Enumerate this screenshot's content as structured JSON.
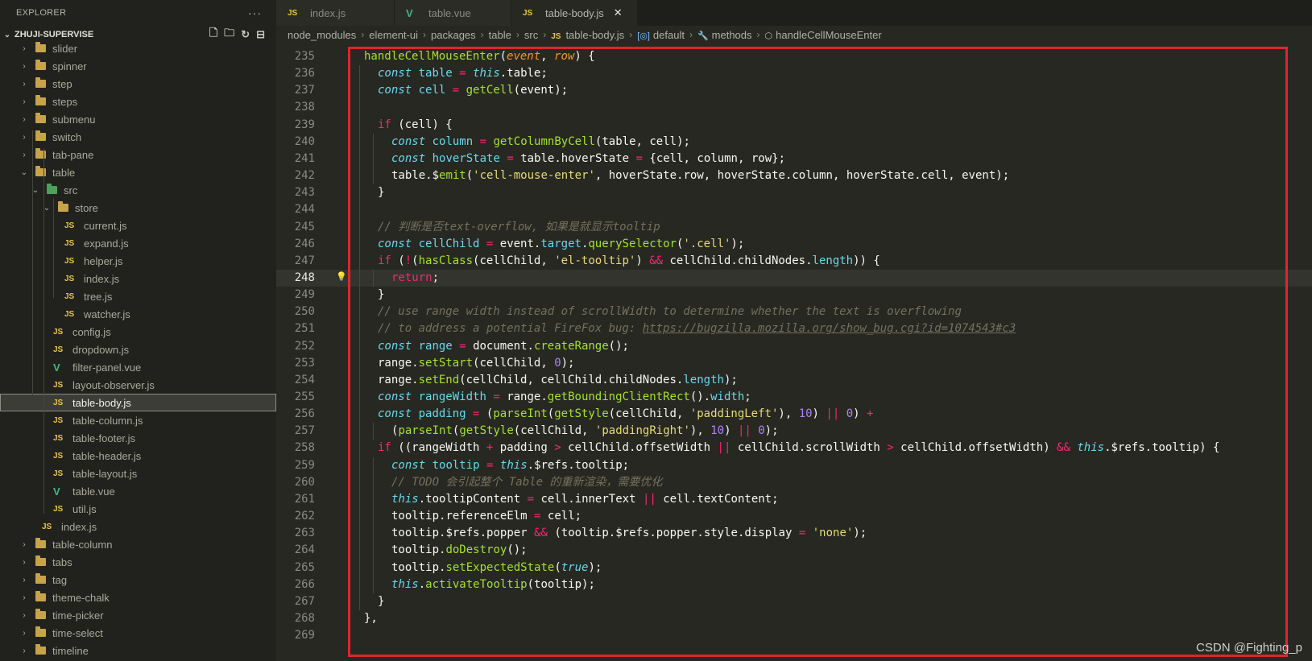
{
  "explorer": {
    "title": "EXPLORER",
    "more": "···",
    "project": "ZHUJI-SUPERVISE",
    "actions": [
      "new-file-icon",
      "new-folder-icon",
      "refresh-icon",
      "collapse-icon"
    ],
    "items": [
      {
        "label": "slider",
        "type": "folder",
        "depth": 1,
        "expanded": false
      },
      {
        "label": "spinner",
        "type": "folder",
        "depth": 1,
        "expanded": false
      },
      {
        "label": "step",
        "type": "folder",
        "depth": 1,
        "expanded": false
      },
      {
        "label": "steps",
        "type": "folder",
        "depth": 1,
        "expanded": false
      },
      {
        "label": "submenu",
        "type": "folder",
        "depth": 1,
        "expanded": false
      },
      {
        "label": "switch",
        "type": "folder",
        "depth": 1,
        "expanded": false
      },
      {
        "label": "tab-pane",
        "type": "folder",
        "depth": 1,
        "expanded": false
      },
      {
        "label": "table",
        "type": "folder",
        "depth": 1,
        "expanded": true
      },
      {
        "label": "src",
        "type": "src-folder",
        "depth": 2,
        "expanded": true
      },
      {
        "label": "store",
        "type": "folder",
        "depth": 3,
        "expanded": true
      },
      {
        "label": "current.js",
        "type": "js",
        "depth": 4
      },
      {
        "label": "expand.js",
        "type": "js",
        "depth": 4
      },
      {
        "label": "helper.js",
        "type": "js",
        "depth": 4
      },
      {
        "label": "index.js",
        "type": "js",
        "depth": 4
      },
      {
        "label": "tree.js",
        "type": "js",
        "depth": 4
      },
      {
        "label": "watcher.js",
        "type": "js",
        "depth": 4
      },
      {
        "label": "config.js",
        "type": "js",
        "depth": 3
      },
      {
        "label": "dropdown.js",
        "type": "js",
        "depth": 3
      },
      {
        "label": "filter-panel.vue",
        "type": "vue",
        "depth": 3
      },
      {
        "label": "layout-observer.js",
        "type": "js",
        "depth": 3
      },
      {
        "label": "table-body.js",
        "type": "js",
        "depth": 3,
        "active": true
      },
      {
        "label": "table-column.js",
        "type": "js",
        "depth": 3
      },
      {
        "label": "table-footer.js",
        "type": "js",
        "depth": 3
      },
      {
        "label": "table-header.js",
        "type": "js",
        "depth": 3
      },
      {
        "label": "table-layout.js",
        "type": "js",
        "depth": 3
      },
      {
        "label": "table.vue",
        "type": "vue",
        "depth": 3
      },
      {
        "label": "util.js",
        "type": "js",
        "depth": 3
      },
      {
        "label": "index.js",
        "type": "js",
        "depth": 2
      },
      {
        "label": "table-column",
        "type": "folder",
        "depth": 1,
        "expanded": false
      },
      {
        "label": "tabs",
        "type": "folder",
        "depth": 1,
        "expanded": false
      },
      {
        "label": "tag",
        "type": "folder",
        "depth": 1,
        "expanded": false
      },
      {
        "label": "theme-chalk",
        "type": "folder",
        "depth": 1,
        "expanded": false
      },
      {
        "label": "time-picker",
        "type": "folder",
        "depth": 1,
        "expanded": false
      },
      {
        "label": "time-select",
        "type": "folder",
        "depth": 1,
        "expanded": false
      },
      {
        "label": "timeline",
        "type": "folder",
        "depth": 1,
        "expanded": false
      }
    ]
  },
  "tabs": [
    {
      "label": "index.js",
      "type": "js",
      "active": false
    },
    {
      "label": "table.vue",
      "type": "vue",
      "active": false
    },
    {
      "label": "table-body.js",
      "type": "js",
      "active": true
    }
  ],
  "tab_badge": "JS",
  "breadcrumb": [
    "node_modules",
    "element-ui",
    "packages",
    "table",
    "src",
    "table-body.js",
    "default",
    "methods",
    "handleCellMouseEnter"
  ],
  "editor": {
    "current_line": 248,
    "lines": [
      {
        "n": 235,
        "i": 1,
        "t": "handleCellMouseEnter(event, row) {"
      },
      {
        "n": 236,
        "i": 2,
        "t": "const table = this.table;"
      },
      {
        "n": 237,
        "i": 2,
        "t": "const cell = getCell(event);"
      },
      {
        "n": 238,
        "i": 0,
        "t": ""
      },
      {
        "n": 239,
        "i": 2,
        "t": "if (cell) {"
      },
      {
        "n": 240,
        "i": 3,
        "t": "const column = getColumnByCell(table, cell);"
      },
      {
        "n": 241,
        "i": 3,
        "t": "const hoverState = table.hoverState = {cell, column, row};"
      },
      {
        "n": 242,
        "i": 3,
        "t": "table.$emit('cell-mouse-enter', hoverState.row, hoverState.column, hoverState.cell, event);"
      },
      {
        "n": 243,
        "i": 2,
        "t": "}"
      },
      {
        "n": 244,
        "i": 0,
        "t": ""
      },
      {
        "n": 245,
        "i": 2,
        "t": "// 判断是否text-overflow, 如果是就显示tooltip"
      },
      {
        "n": 246,
        "i": 2,
        "t": "const cellChild = event.target.querySelector('.cell');"
      },
      {
        "n": 247,
        "i": 2,
        "t": "if (!(hasClass(cellChild, 'el-tooltip') && cellChild.childNodes.length)) {"
      },
      {
        "n": 248,
        "i": 3,
        "t": "return;"
      },
      {
        "n": 249,
        "i": 2,
        "t": "}"
      },
      {
        "n": 250,
        "i": 2,
        "t": "// use range width instead of scrollWidth to determine whether the text is overflowing"
      },
      {
        "n": 251,
        "i": 2,
        "t": "// to address a potential FireFox bug: https://bugzilla.mozilla.org/show_bug.cgi?id=1074543#c3"
      },
      {
        "n": 252,
        "i": 2,
        "t": "const range = document.createRange();"
      },
      {
        "n": 253,
        "i": 2,
        "t": "range.setStart(cellChild, 0);"
      },
      {
        "n": 254,
        "i": 2,
        "t": "range.setEnd(cellChild, cellChild.childNodes.length);"
      },
      {
        "n": 255,
        "i": 2,
        "t": "const rangeWidth = range.getBoundingClientRect().width;"
      },
      {
        "n": 256,
        "i": 2,
        "t": "const padding = (parseInt(getStyle(cellChild, 'paddingLeft'), 10) || 0) +"
      },
      {
        "n": 257,
        "i": 3,
        "t": "(parseInt(getStyle(cellChild, 'paddingRight'), 10) || 0);"
      },
      {
        "n": 258,
        "i": 2,
        "t": "if ((rangeWidth + padding > cellChild.offsetWidth || cellChild.scrollWidth > cellChild.offsetWidth) && this.$refs.tooltip) {"
      },
      {
        "n": 259,
        "i": 3,
        "t": "const tooltip = this.$refs.tooltip;"
      },
      {
        "n": 260,
        "i": 3,
        "t": "// TODO 会引起整个 Table 的重新渲染，需要优化"
      },
      {
        "n": 261,
        "i": 3,
        "t": "this.tooltipContent = cell.innerText || cell.textContent;"
      },
      {
        "n": 262,
        "i": 3,
        "t": "tooltip.referenceElm = cell;"
      },
      {
        "n": 263,
        "i": 3,
        "t": "tooltip.$refs.popper && (tooltip.$refs.popper.style.display = 'none');"
      },
      {
        "n": 264,
        "i": 3,
        "t": "tooltip.doDestroy();"
      },
      {
        "n": 265,
        "i": 3,
        "t": "tooltip.setExpectedState(true);"
      },
      {
        "n": 266,
        "i": 3,
        "t": "this.activateTooltip(tooltip);"
      },
      {
        "n": 267,
        "i": 2,
        "t": "}"
      },
      {
        "n": 268,
        "i": 1,
        "t": "},"
      },
      {
        "n": 269,
        "i": 0,
        "t": ""
      }
    ]
  },
  "watermark": "CSDN @Fighting_p",
  "colors": {
    "highlight_box": "#e0242b",
    "background": "#272822"
  }
}
